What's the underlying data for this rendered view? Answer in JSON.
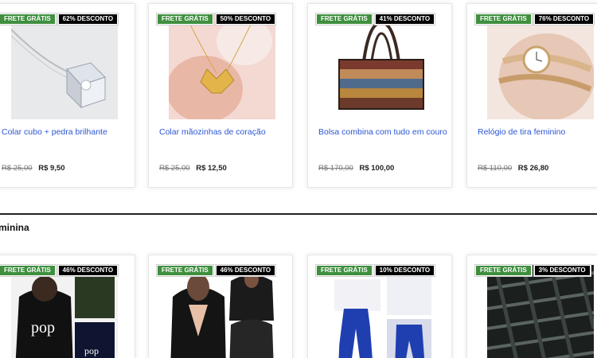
{
  "row1": [
    {
      "shipping": "FRETE GRÁTIS",
      "discount": "62% DESCONTO",
      "title": "Colar cubo + pedra brilhante",
      "old_price": "R$ 25,00",
      "new_price": "R$ 9,50"
    },
    {
      "shipping": "FRETE GRÁTIS",
      "discount": "50% DESCONTO",
      "title": "Colar mãozinhas de coração",
      "old_price": "R$ 25,00",
      "new_price": "R$ 12,50"
    },
    {
      "shipping": "FRETE GRÁTIS",
      "discount": "41% DESCONTO",
      "title": "Bolsa combina com tudo em couro",
      "old_price": "R$ 170,00",
      "new_price": "R$ 100,00"
    },
    {
      "shipping": "FRETE GRÁTIS",
      "discount": "76% DESCONTO",
      "title": "Relógio de tira feminino",
      "old_price": "R$ 110,00",
      "new_price": "R$ 26,80"
    }
  ],
  "section": {
    "title": "minina"
  },
  "row2": [
    {
      "shipping": "FRETE GRÁTIS",
      "discount": "46% DESCONTO"
    },
    {
      "shipping": "FRETE GRÁTIS",
      "discount": "46% DESCONTO"
    },
    {
      "shipping": "FRETE GRÁTIS",
      "discount": "10% DESCONTO"
    },
    {
      "shipping": "FRETE GRÁTIS",
      "discount": "3% DESCONTO"
    }
  ],
  "colors": {
    "shipping_badge": "#3f8f3f",
    "discount_badge": "#000000",
    "title_link": "#2b56d6"
  }
}
